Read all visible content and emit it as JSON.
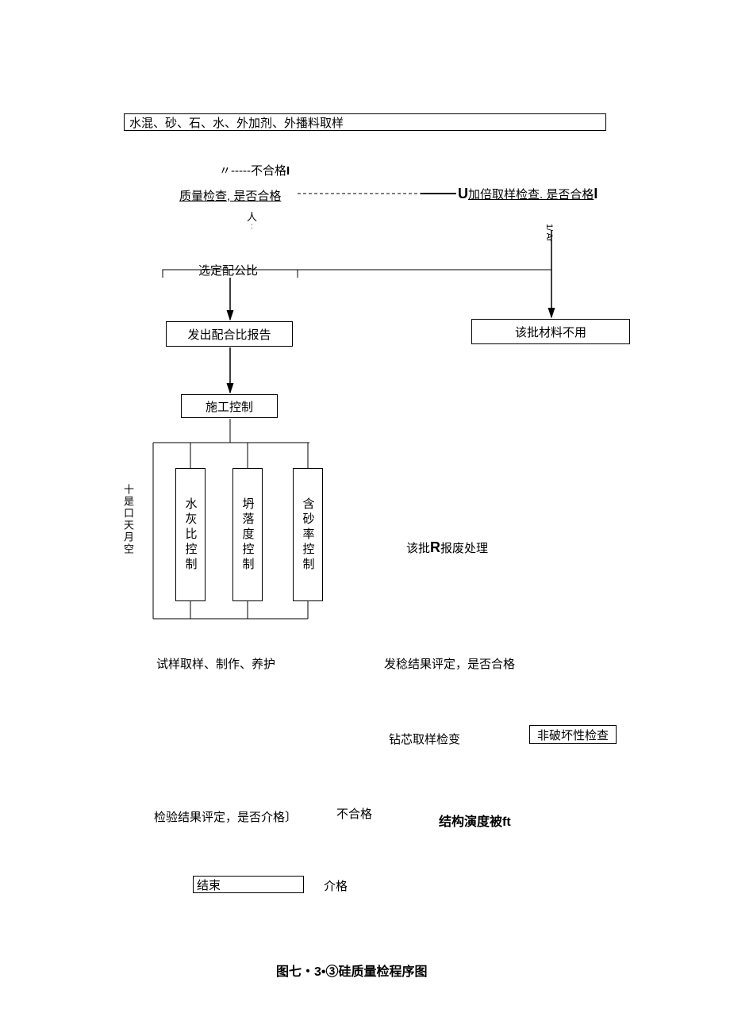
{
  "top_box": "水混、砂、石、水、外加剂、外播料取样",
  "dash_label": "〃-----不合格",
  "qc_label": "质量检查, 是否合格",
  "double_label": "加倍取样检查. 是否合格",
  "after_qc": "人",
  "select_ratio": "选定配公比",
  "issue_report": "发出配合比报告",
  "reject_material": "该批材料不用",
  "construction_control": "施工控制",
  "side_vertical": "十是口天月空",
  "col1": "水灰比控制",
  "col2": "坍落度控制",
  "col3": "含砂率控制",
  "scrap": "该批R报废处理",
  "sample_make": "试样取样、制作、养护",
  "eval_result": "发稔结果评定，是否合格",
  "core_check": "钻芯取样检变",
  "nondestructive": "非破坏性检查",
  "eval_final": "检验结果评定，是否介格〕",
  "unqualified": "不合格",
  "struct_strength": "结构演度被ft",
  "end": "结束",
  "qualified": "介格",
  "figure_title": "图七・3•③硅质量检程序图",
  "U": "U",
  "I": "I",
  "R": "R",
  "small_top_right": "1/ Ar",
  "chart_data": {
    "type": "flowchart",
    "title": "图七・3•③硅质量检程序图",
    "nodes": [
      {
        "id": "n1",
        "label": "水混、砂、石、水、外加剂、外播料取样"
      },
      {
        "id": "n2",
        "label": "质量检查, 是否合格"
      },
      {
        "id": "n3",
        "label": "加倍取样检查. 是否合格",
        "path_label": "不合格"
      },
      {
        "id": "n4",
        "label": "选定配公比"
      },
      {
        "id": "n5",
        "label": "发出配合比报告"
      },
      {
        "id": "n6",
        "label": "该批材料不用"
      },
      {
        "id": "n7",
        "label": "施工控制"
      },
      {
        "id": "n8a",
        "label": "水灰比控制"
      },
      {
        "id": "n8b",
        "label": "坍落度控制"
      },
      {
        "id": "n8c",
        "label": "含砂率控制"
      },
      {
        "id": "n9",
        "label": "试样取样、制作、养护"
      },
      {
        "id": "n10",
        "label": "发稔结果评定，是否合格"
      },
      {
        "id": "n11",
        "label": "该批R报废处理"
      },
      {
        "id": "n12",
        "label": "钻芯取样检变"
      },
      {
        "id": "n13",
        "label": "非破坏性检查"
      },
      {
        "id": "n14",
        "label": "检验结果评定，是否介格〕"
      },
      {
        "id": "n15",
        "label": "结构演度被ft",
        "path_label": "不合格"
      },
      {
        "id": "n16",
        "label": "结束",
        "path_label": "介格"
      }
    ],
    "edges": [
      {
        "from": "n1",
        "to": "n2"
      },
      {
        "from": "n2",
        "to": "n3",
        "label": "不合格"
      },
      {
        "from": "n2",
        "to": "n4"
      },
      {
        "from": "n3",
        "to": "n6"
      },
      {
        "from": "n4",
        "to": "n5"
      },
      {
        "from": "n5",
        "to": "n7"
      },
      {
        "from": "n7",
        "to": "n8a"
      },
      {
        "from": "n7",
        "to": "n8b"
      },
      {
        "from": "n7",
        "to": "n8c"
      },
      {
        "from": "n8a",
        "to": "n9"
      },
      {
        "from": "n8b",
        "to": "n9"
      },
      {
        "from": "n8c",
        "to": "n9"
      },
      {
        "from": "n9",
        "to": "n10"
      },
      {
        "from": "n10",
        "to": "n11"
      },
      {
        "from": "n10",
        "to": "n12"
      },
      {
        "from": "n10",
        "to": "n13"
      },
      {
        "from": "n12",
        "to": "n14"
      },
      {
        "from": "n13",
        "to": "n14"
      },
      {
        "from": "n14",
        "to": "n15",
        "label": "不合格"
      },
      {
        "from": "n14",
        "to": "n16",
        "label": "介格"
      }
    ]
  }
}
